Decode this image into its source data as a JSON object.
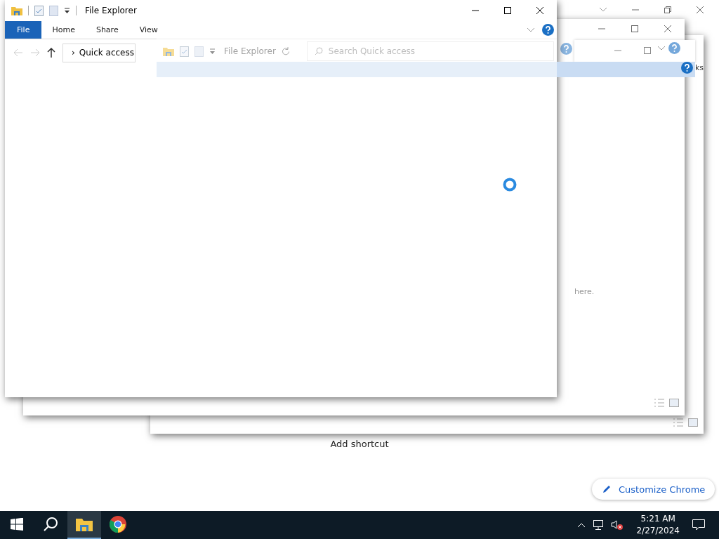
{
  "browser_page": {
    "add_shortcut": "Add shortcut",
    "customize_button": "Customize Chrome"
  },
  "back_windows": [
    {
      "kind": "rear",
      "fragment": "ks"
    },
    {
      "kind": "middle",
      "fragment": "here."
    },
    {
      "kind": "strip"
    }
  ],
  "front_window": {
    "title": "File Explorer",
    "ribbon_tabs": [
      {
        "label": "File",
        "selected": true
      },
      {
        "label": "Home",
        "selected": false
      },
      {
        "label": "Share",
        "selected": false
      },
      {
        "label": "View",
        "selected": false
      }
    ],
    "address_separator": "›",
    "address": "Quick access"
  },
  "ghost_window": {
    "title": "File Explorer",
    "search": {
      "placeholder": "Search Quick access"
    }
  },
  "taskbar": {
    "apps": [
      {
        "kind": "explorer",
        "active": true
      },
      {
        "kind": "chrome",
        "active": false
      }
    ],
    "time": "5:21 AM",
    "date": "2/27/2024"
  }
}
